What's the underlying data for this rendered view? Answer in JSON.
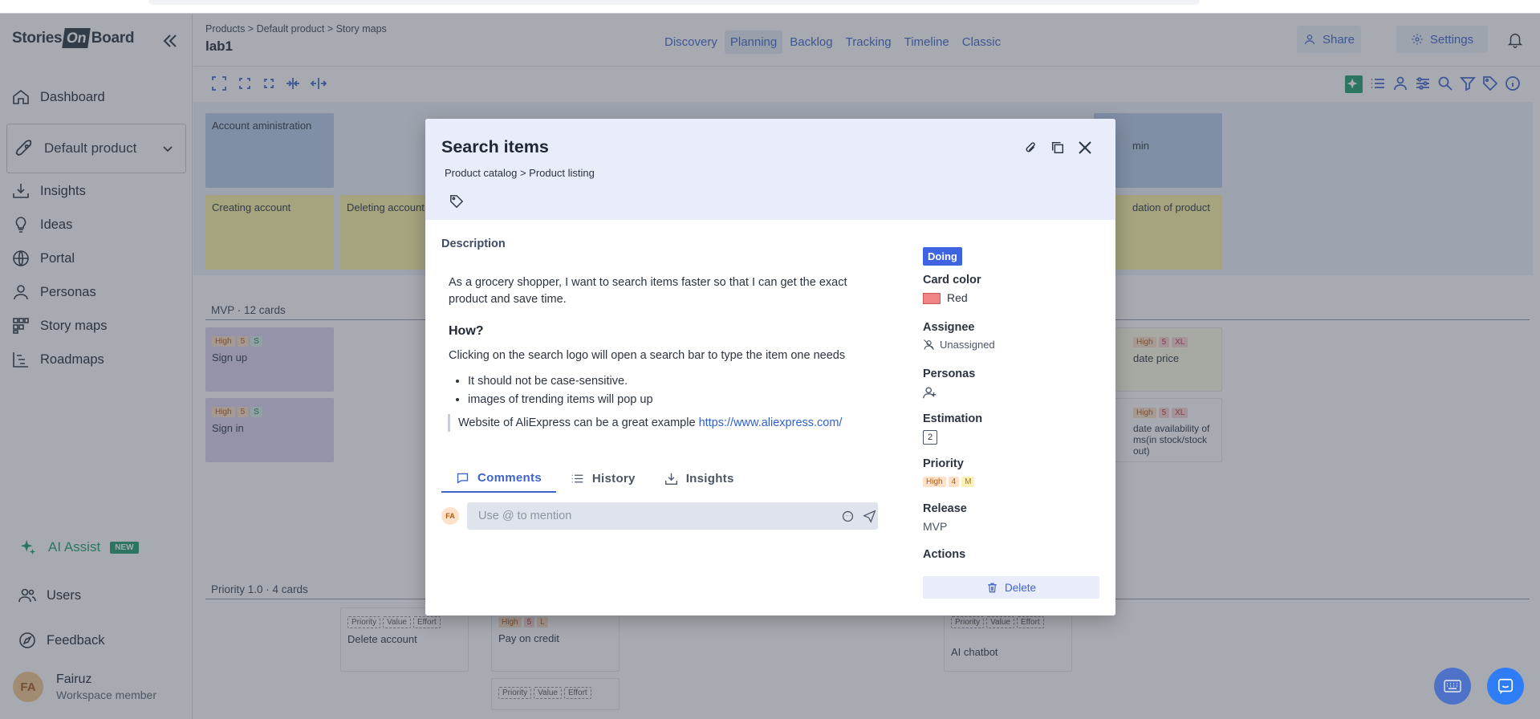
{
  "app": {
    "logo_left": "Stories",
    "logo_mid": "On",
    "logo_right": "Board"
  },
  "sidebar": {
    "items": [
      {
        "label": "Dashboard",
        "icon": "home-icon"
      },
      {
        "label": "Insights",
        "icon": "inbox-download-icon"
      },
      {
        "label": "Ideas",
        "icon": "lightbulb-icon"
      },
      {
        "label": "Portal",
        "icon": "globe-icon"
      },
      {
        "label": "Personas",
        "icon": "person-icon"
      },
      {
        "label": "Story maps",
        "icon": "story-map-icon"
      },
      {
        "label": "Roadmaps",
        "icon": "roadmap-icon"
      }
    ],
    "product": "Default product",
    "ai_assist": "AI Assist",
    "ai_badge": "NEW",
    "users": "Users",
    "feedback": "Feedback",
    "user": {
      "initials": "FA",
      "name": "Fairuz",
      "role": "Workspace member"
    }
  },
  "header": {
    "breadcrumb": "Products > Default product > Story maps",
    "title": "lab1",
    "tabs": [
      "Discovery",
      "Planning",
      "Backlog",
      "Tracking",
      "Timeline",
      "Classic"
    ],
    "active_tab": "Planning",
    "share": "Share",
    "settings": "Settings"
  },
  "board": {
    "activities": [
      "Account aministration",
      "min"
    ],
    "steps": [
      "Creating account",
      "Deleting account",
      "dation of product"
    ],
    "mvp_label": "MVP · 12 cards",
    "priority_label": "Priority 1.0 · 4 cards",
    "cards": {
      "signup": "Sign up",
      "signin": "Sign in",
      "update_price": "date price",
      "update_avail": "date availability of\nms(in stock/stock out)",
      "delete_account": "Delete account",
      "pay_credit": "Pay on credit",
      "ai_chatbot": "AI chatbot"
    },
    "tags": {
      "high": "High",
      "five": "5",
      "s": "S",
      "xl": "XL",
      "l": "L",
      "priority": "Priority",
      "value": "Value",
      "effort": "Effort"
    }
  },
  "modal": {
    "title": "Search items",
    "path": "Product catalog  >  Product listing",
    "description_label": "Description",
    "description": "As a grocery shopper, I want to search items faster so that I can get the exact product and save time.",
    "how_heading": "How?",
    "how_text": "Clicking on the search logo will open a search bar to type the item one needs",
    "bullets": [
      "It should not be case-sensitive.",
      "images of trending items will pop up"
    ],
    "quote_text": "Website of AliExpress can be a great example ",
    "quote_link": "https://www.aliexpress.com/",
    "tabs": [
      "Comments",
      "History",
      "Insights"
    ],
    "comment_placeholder": "Use @ to mention",
    "commenter_initials": "FA",
    "status": "Doing",
    "card_color_label": "Card color",
    "card_color": "Red",
    "card_color_hex": "#f08585",
    "assignee_label": "Assignee",
    "assignee": "Unassigned",
    "personas_label": "Personas",
    "estimation_label": "Estimation",
    "estimation": "2",
    "priority_label": "Priority",
    "priority_tags": [
      "High",
      "4",
      "M"
    ],
    "release_label": "Release",
    "release": "MVP",
    "actions_label": "Actions",
    "delete": "Delete"
  }
}
